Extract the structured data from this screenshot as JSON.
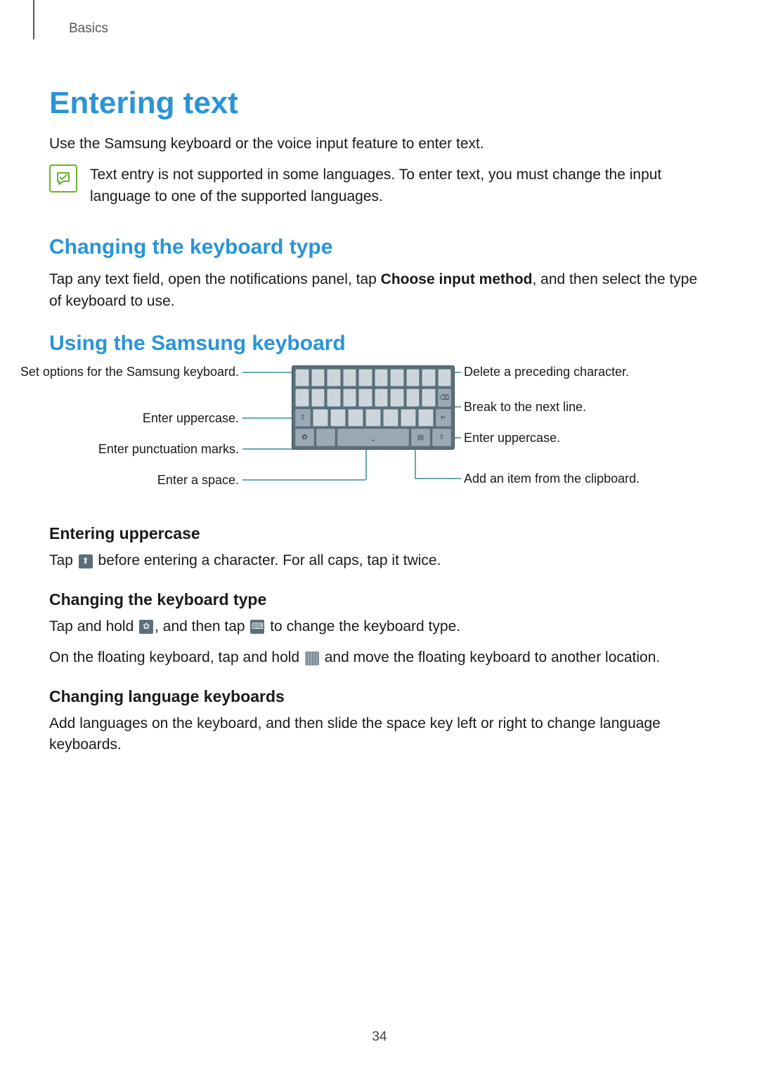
{
  "breadcrumb": "Basics",
  "title": "Entering text",
  "intro": "Use the Samsung keyboard or the voice input feature to enter text.",
  "note": "Text entry is not supported in some languages. To enter text, you must change the input language to one of the supported languages.",
  "sections": {
    "changing_keyboard_type": {
      "heading": "Changing the keyboard type",
      "body_prefix": "Tap any text field, open the notifications panel, tap ",
      "body_bold": "Choose input method",
      "body_suffix": ", and then select the type of keyboard to use."
    },
    "using_samsung_keyboard": {
      "heading": "Using the Samsung keyboard"
    }
  },
  "diagram": {
    "left": {
      "set_options": "Set options for the Samsung keyboard.",
      "upper": "Enter uppercase.",
      "punct": "Enter punctuation marks.",
      "space": "Enter a space."
    },
    "right": {
      "delete": "Delete a preceding character.",
      "break": "Break to the next line.",
      "upper": "Enter uppercase.",
      "clip": "Add an item from the clipboard."
    }
  },
  "sub": {
    "entering_uppercase": {
      "heading": "Entering uppercase",
      "p1a": "Tap ",
      "p1b": " before entering a character. For all caps, tap it twice."
    },
    "changing_keyboard_type2": {
      "heading": "Changing the keyboard type",
      "p1a": "Tap and hold ",
      "p1b": ", and then tap ",
      "p1c": " to change the keyboard type.",
      "p2a": "On the floating keyboard, tap and hold ",
      "p2b": " and move the floating keyboard to another location."
    },
    "changing_lang": {
      "heading": "Changing language keyboards",
      "p1": "Add languages on the keyboard, and then slide the space key left or right to change language keyboards."
    }
  },
  "page_number": "34"
}
